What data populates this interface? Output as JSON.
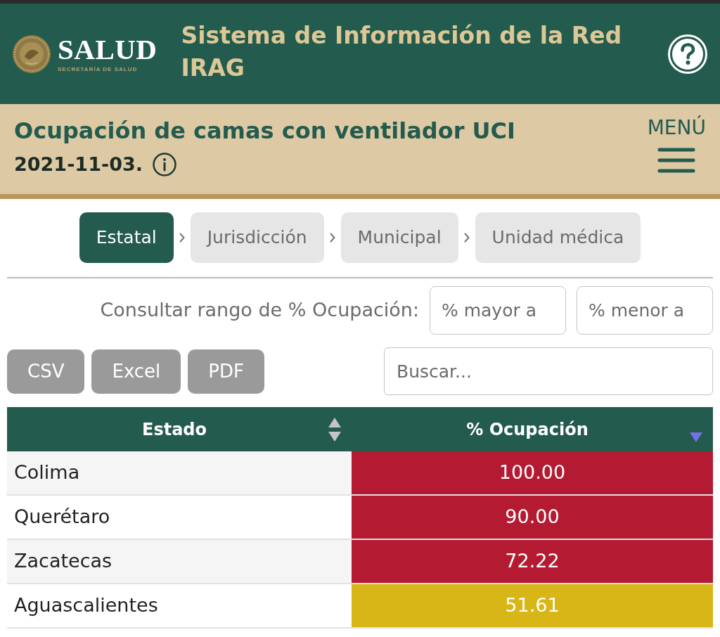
{
  "header": {
    "brand": {
      "name": "SALUD",
      "subtitle": "SECRETARÍA DE SALUD"
    },
    "title": "Sistema de Información de la Red IRAG"
  },
  "subheader": {
    "title": "Ocupación de camas con ventilador UCI",
    "date": "2021-11-03.",
    "menu_label": "MENÚ"
  },
  "levels": [
    {
      "label": "Estatal",
      "selected": true
    },
    {
      "label": "Jurisdicción",
      "selected": false
    },
    {
      "label": "Municipal",
      "selected": false
    },
    {
      "label": "Unidad médica",
      "selected": false
    }
  ],
  "range_filter": {
    "label": "Consultar rango de % Ocupación:",
    "fields": [
      {
        "placeholder": "% mayor a"
      },
      {
        "placeholder": "% menor a"
      }
    ]
  },
  "export_buttons": [
    "CSV",
    "Excel",
    "PDF"
  ],
  "search": {
    "placeholder": "Buscar..."
  },
  "table": {
    "columns": [
      {
        "label": "Estado",
        "sorted": false
      },
      {
        "label": "% Ocupación",
        "sorted": true,
        "descending": true
      }
    ],
    "rows": [
      {
        "estado": "Colima",
        "ocupacion": "100.00",
        "color": "#b41a31"
      },
      {
        "estado": "Querétaro",
        "ocupacion": "90.00",
        "color": "#b41a31"
      },
      {
        "estado": "Zacatecas",
        "ocupacion": "72.22",
        "color": "#b41a31"
      },
      {
        "estado": "Aguascalientes",
        "ocupacion": "51.61",
        "color": "#d9b618"
      }
    ]
  }
}
